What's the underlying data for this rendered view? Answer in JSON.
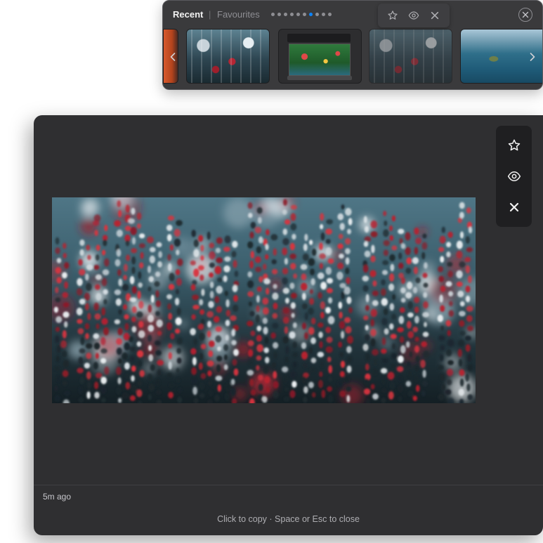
{
  "strip": {
    "tabs": [
      {
        "label": "Recent",
        "active": true
      },
      {
        "label": "Favourites",
        "active": false
      }
    ],
    "separator": "|",
    "page_dots": {
      "count": 10,
      "active_index": 6
    },
    "close_icon": "close-circle-icon",
    "thumbnails": [
      {
        "kind": "orange-edge"
      },
      {
        "kind": "red-white-flowers"
      },
      {
        "kind": "app-screenshot"
      },
      {
        "kind": "red-white-flowers-hovered"
      },
      {
        "kind": "lake-islands"
      }
    ],
    "hover_actions": [
      "star-icon",
      "eye-icon",
      "close-icon"
    ],
    "nav": {
      "left": "chevron-left-icon",
      "right": "chevron-right-icon"
    }
  },
  "preview": {
    "image": "red-white-flowers",
    "actions": [
      "star-icon",
      "eye-icon",
      "close-icon"
    ],
    "timestamp": "5m ago",
    "hint": "Click to copy · Space or Esc to close"
  },
  "colors": {
    "panel_bg": "#3a3a3c",
    "card_bg": "#2f2f31",
    "accent_dot": "#0a84ff",
    "text_primary": "#f2f2f2",
    "text_secondary": "#8e8e93"
  }
}
